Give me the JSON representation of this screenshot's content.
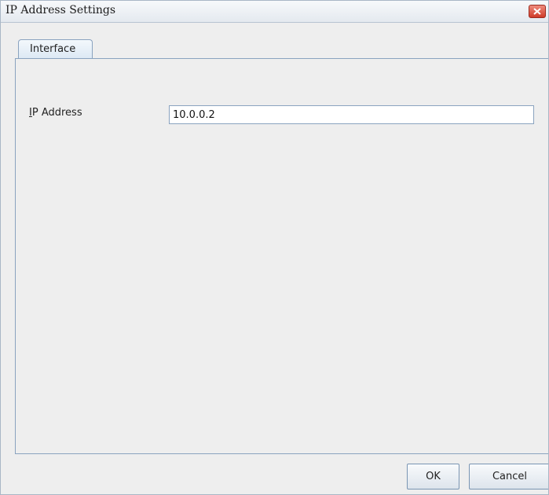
{
  "window": {
    "title": "IP Address Settings",
    "close_icon": "close-icon"
  },
  "tabs": [
    {
      "label": "Interface",
      "selected": true
    }
  ],
  "form": {
    "ip_label_mnemonic": "I",
    "ip_label_rest": "P Address",
    "ip_value": "10.0.0.2"
  },
  "buttons": {
    "ok": "OK",
    "cancel": "Cancel"
  },
  "colors": {
    "close_button": "#cf3b28",
    "tab_border": "#8aa3bf",
    "window_bg": "#eeeeee"
  }
}
